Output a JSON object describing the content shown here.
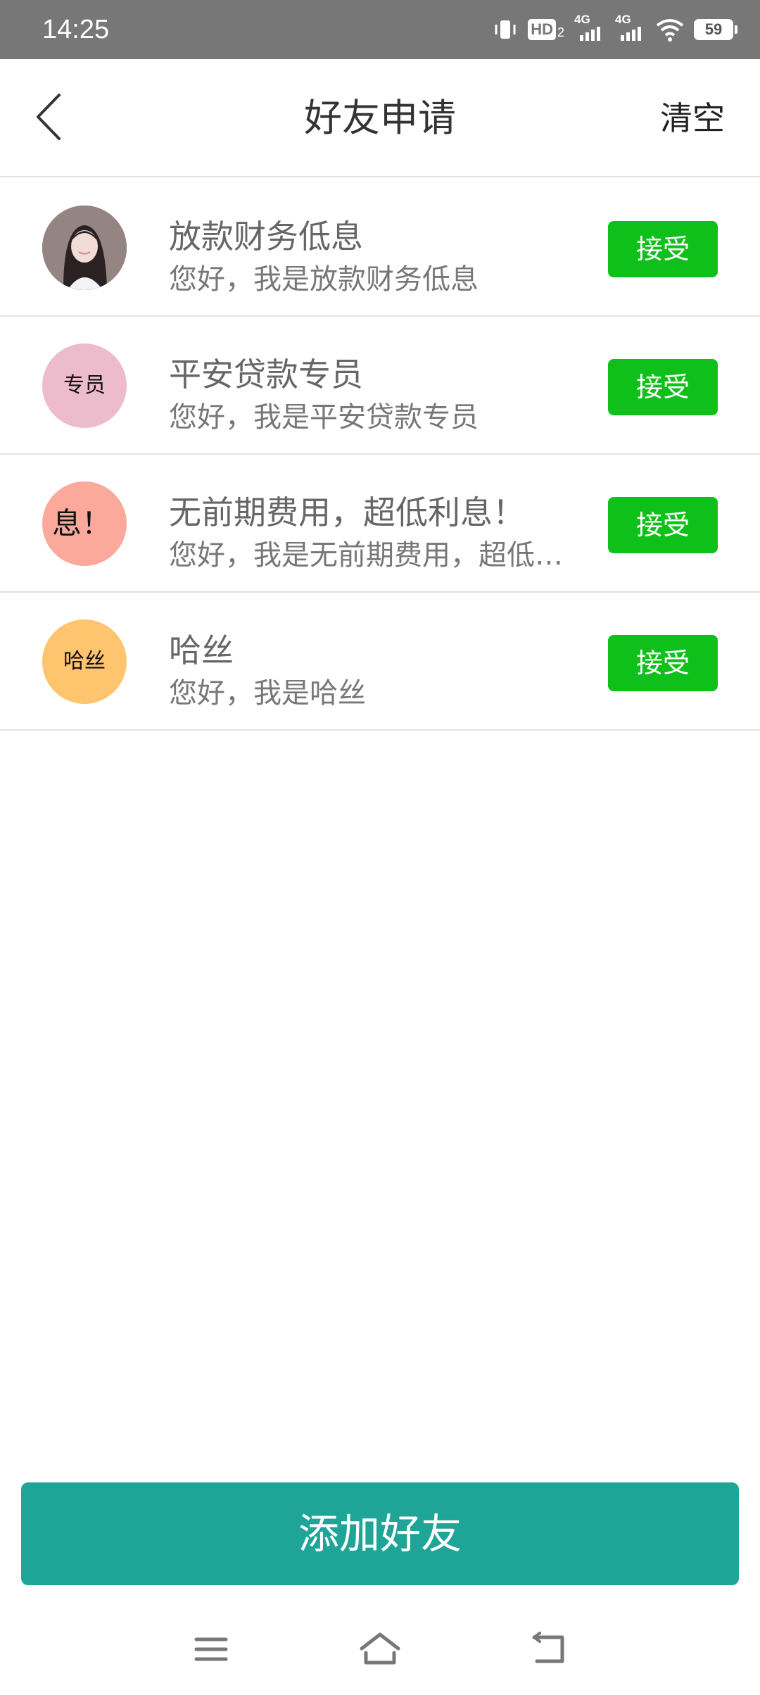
{
  "status_bar": {
    "time": "14:25",
    "hd_label": "HD",
    "hd_sub": "2",
    "signal1_label": "4G",
    "signal2_label": "4G",
    "battery": "59"
  },
  "header": {
    "title": "好友申请",
    "clear_label": "清空"
  },
  "requests": [
    {
      "name": "放款财务低息",
      "message": "您好，我是放款财务低息",
      "avatar_text": "",
      "avatar_color": "#6b5a5a",
      "accept_label": "接受"
    },
    {
      "name": "平安贷款专员",
      "message": "您好，我是平安贷款专员",
      "avatar_text": "专员",
      "avatar_color": "#ecbccc",
      "accept_label": "接受"
    },
    {
      "name": "无前期费用，超低利息！",
      "message": "您好，我是无前期费用，超低利息！",
      "avatar_text": "息！",
      "avatar_color": "#fba99b",
      "accept_label": "接受"
    },
    {
      "name": "哈丝",
      "message": "您好，我是哈丝",
      "avatar_text": "哈丝",
      "avatar_color": "#fec46e",
      "accept_label": "接受"
    }
  ],
  "add_friend_label": "添加好友",
  "colors": {
    "accept_green": "#10c01a",
    "primary_teal": "#1fa598",
    "status_bar_gray": "#777777"
  }
}
